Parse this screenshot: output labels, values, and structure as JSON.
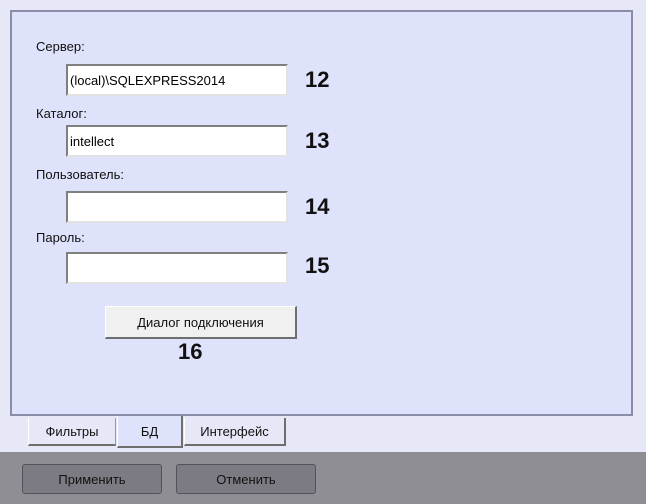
{
  "server": {
    "label": "Сервер:",
    "value": "(local)\\SQLEXPRESS2014",
    "marker": "12"
  },
  "catalog": {
    "label": "Каталог:",
    "value": "intellect",
    "marker": "13"
  },
  "user": {
    "label": "Пользователь:",
    "value": "",
    "marker": "14"
  },
  "password": {
    "label": "Пароль:",
    "value": "",
    "marker": "15"
  },
  "connection_dialog": {
    "label": "Диалог подключения",
    "marker": "16"
  },
  "tabs": [
    {
      "label": "Фильтры",
      "active": false
    },
    {
      "label": "БД",
      "active": true
    },
    {
      "label": "Интерфейс",
      "active": false
    }
  ],
  "actions": {
    "apply_label": "Применить",
    "cancel_label": "Отменить"
  },
  "colors": {
    "panel_background": "#dfe2fb",
    "bottom_bar": "#8f8e94"
  }
}
